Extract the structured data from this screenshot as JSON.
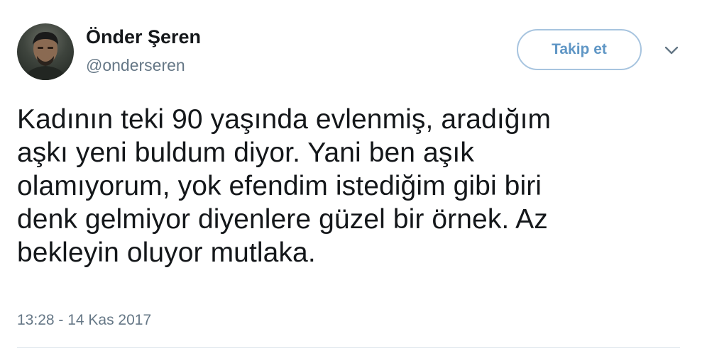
{
  "user": {
    "display_name": "Önder Şeren",
    "handle": "@onderseren",
    "avatar_icon": "profile-photo"
  },
  "actions": {
    "follow_label": "Takip et",
    "more_icon": "chevron-down-icon"
  },
  "tweet": {
    "text": "Kadının teki 90 yaşında evlenmiş, aradığım\naşkı yeni buldum diyor. Yani ben aşık\nolamıyorum, yok efendim istediğim gibi biri\ndenk gelmiyor diyenlere güzel bir örnek. Az\nbekleyin oluyor mutlaka.",
    "timestamp": "13:28 - 14 Kas 2017"
  },
  "colors": {
    "follow_border": "#a7c4df",
    "follow_text": "#5f96c5",
    "secondary_text": "#657786",
    "primary_text": "#14171a"
  }
}
